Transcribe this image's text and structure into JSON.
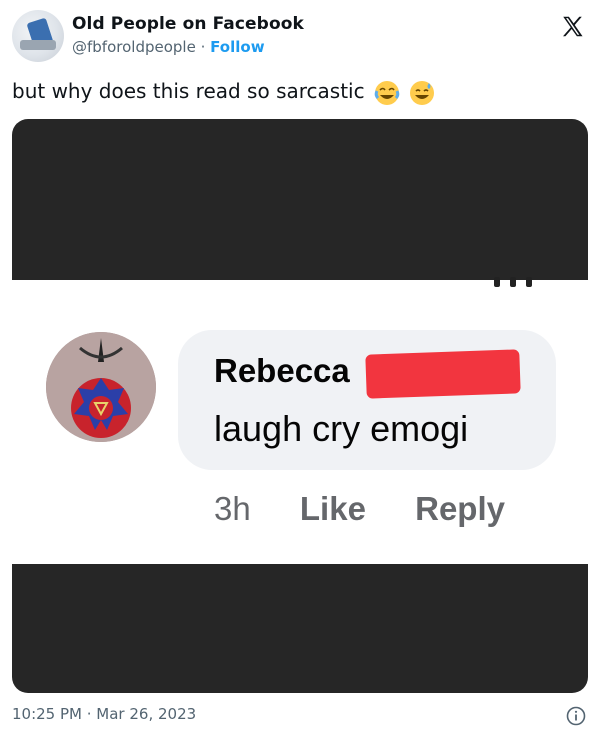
{
  "author": {
    "name": "Old People on Facebook",
    "handle": "@fbforoldpeople",
    "separator": "·",
    "follow_label": "Follow"
  },
  "tweet": {
    "text": "but why does this read so sarcastic",
    "emojis": [
      "face-with-tears-of-joy",
      "grinning-face-with-sweat"
    ]
  },
  "embedded_comment": {
    "commenter_first_name": "Rebecca",
    "comment_text": "laugh cry emogi",
    "time_ago": "3h",
    "like_label": "Like",
    "reply_label": "Reply"
  },
  "footer": {
    "timestamp": "10:25 PM · Mar 26, 2023"
  },
  "colors": {
    "follow_blue": "#1d9bf0",
    "text_primary": "#0f1419",
    "text_secondary": "#536471",
    "redaction_red": "#f2353f",
    "media_dark": "#262626",
    "comment_bubble": "#f0f2f5"
  },
  "icons": {
    "close": "x-logo-icon",
    "info": "info-icon"
  }
}
